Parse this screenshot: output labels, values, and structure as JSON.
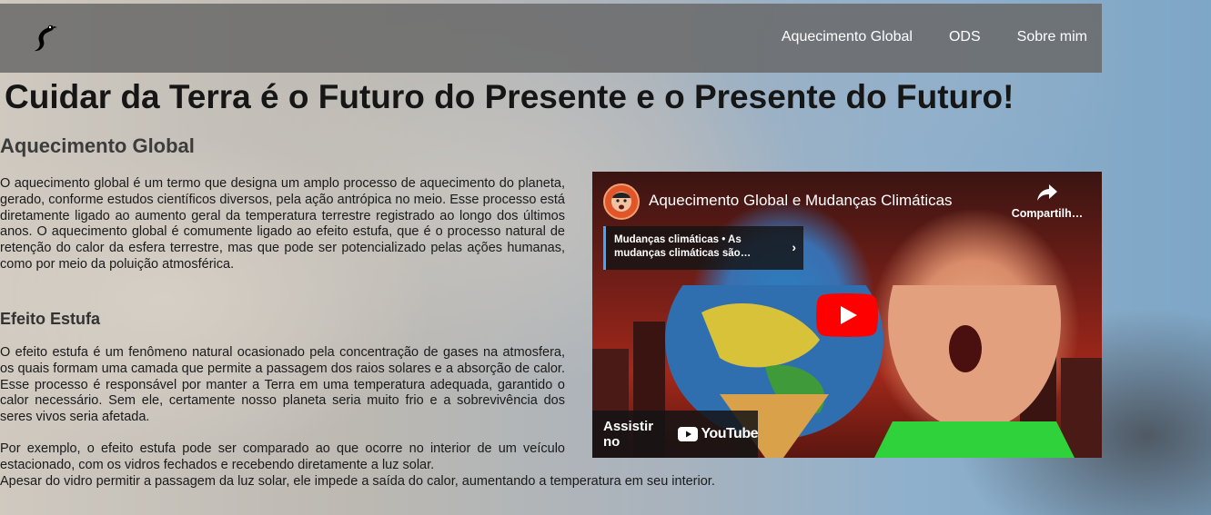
{
  "nav": {
    "links": [
      "Aquecimento Global",
      "ODS",
      "Sobre mim"
    ]
  },
  "page_title": "Cuidar da Terra é o Futuro do Presente e o Presente do Futuro!",
  "section": {
    "heading": "Aquecimento Global",
    "paragraph_1": "O aquecimento global é um termo que designa um amplo processo de aquecimento do planeta, gerado, conforme estudos científicos diversos, pela ação antrópica no meio. Esse processo está diretamente ligado ao aumento geral da temperatura terrestre registrado ao longo dos últimos anos. O aquecimento global é comumente ligado ao efeito estufa, que é o processo natural de retenção do calor da esfera terrestre, mas que pode ser potencializado pelas ações humanas, como por meio da poluição atmosférica.",
    "subheading": "Efeito Estufa",
    "paragraph_2": "O efeito estufa é um fenômeno natural ocasionado pela concentração de gases na atmosfera, os quais formam uma camada que permite a passagem dos raios solares e a absorção de calor. Esse processo é responsável por manter a Terra em uma temperatura adequada, garantido o calor necessário. Sem ele, certamente nosso planeta seria muito frio e a sobrevivência dos seres vivos seria afetada.",
    "paragraph_3": "Por exemplo, o efeito estufa pode ser comparado ao que ocorre no interior de um veículo estacionado, com os vidros fechados e recebendo diretamente a luz solar.",
    "paragraph_3_last": "Apesar do vidro permitir a passagem da luz solar, ele impede a saída do calor, aumentando a temperatura em seu interior."
  },
  "video": {
    "title": "Aquecimento Global e Mudanças Climáticas",
    "share_label": "Compartilh…",
    "playlist_card": "Mudanças climáticas • As mudanças climáticas são…",
    "watch_on": "Assistir no",
    "youtube": "YouTube",
    "play_color": "#ff0000"
  },
  "colors": {
    "nav_bg": "#696969",
    "title": "#161616"
  }
}
